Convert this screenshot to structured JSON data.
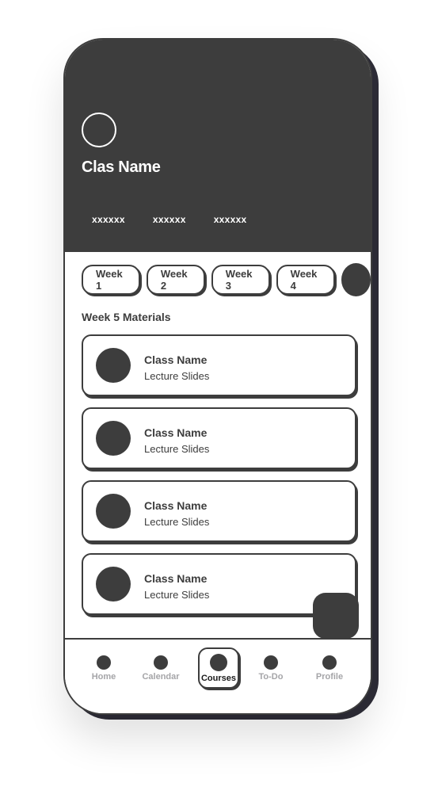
{
  "header": {
    "title": "Clas Name",
    "tabs": [
      "xxxxxx",
      "xxxxxx",
      "xxxxxx"
    ]
  },
  "weeks": {
    "chips": [
      "Week 1",
      "Week 2",
      "Week 3",
      "Week 4"
    ]
  },
  "section": {
    "label": "Week 5 Materials"
  },
  "materials": [
    {
      "title": "Class Name",
      "subtitle": "Lecture Slides"
    },
    {
      "title": "Class Name",
      "subtitle": "Lecture Slides"
    },
    {
      "title": "Class Name",
      "subtitle": "Lecture Slides"
    },
    {
      "title": "Class Name",
      "subtitle": "Lecture Slides"
    }
  ],
  "nav": {
    "items": [
      {
        "label": "Home"
      },
      {
        "label": "Calendar"
      },
      {
        "label": "Courses"
      },
      {
        "label": "To-Do"
      },
      {
        "label": "Profile"
      }
    ],
    "active": "Courses"
  },
  "colors": {
    "dark": "#3d3d3d",
    "muted": "#a5a5a8",
    "background": "#ffffff"
  }
}
